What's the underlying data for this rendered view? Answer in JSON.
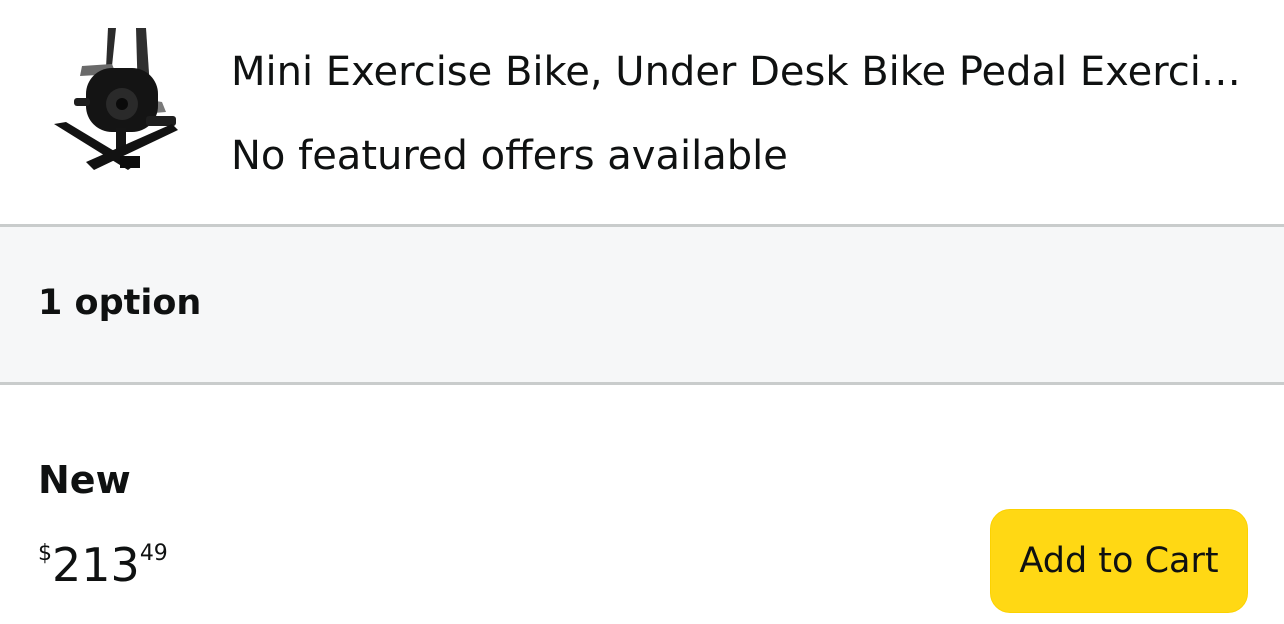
{
  "product": {
    "title": "Mini Exercise Bike, Under Desk Bike Pedal Exerciser",
    "offer_status": "No featured offers available",
    "image_icon": "exercise-bike-product-image"
  },
  "options": {
    "label": "1 option"
  },
  "offer": {
    "condition": "New",
    "price": {
      "currency_symbol": "$",
      "whole": "213",
      "fraction": "49"
    },
    "add_to_cart_label": "Add to Cart"
  },
  "colors": {
    "button_yellow": "#ffd814",
    "options_bg": "#f6f7f8",
    "divider": "#c9cccc",
    "text": "#0f1111"
  }
}
